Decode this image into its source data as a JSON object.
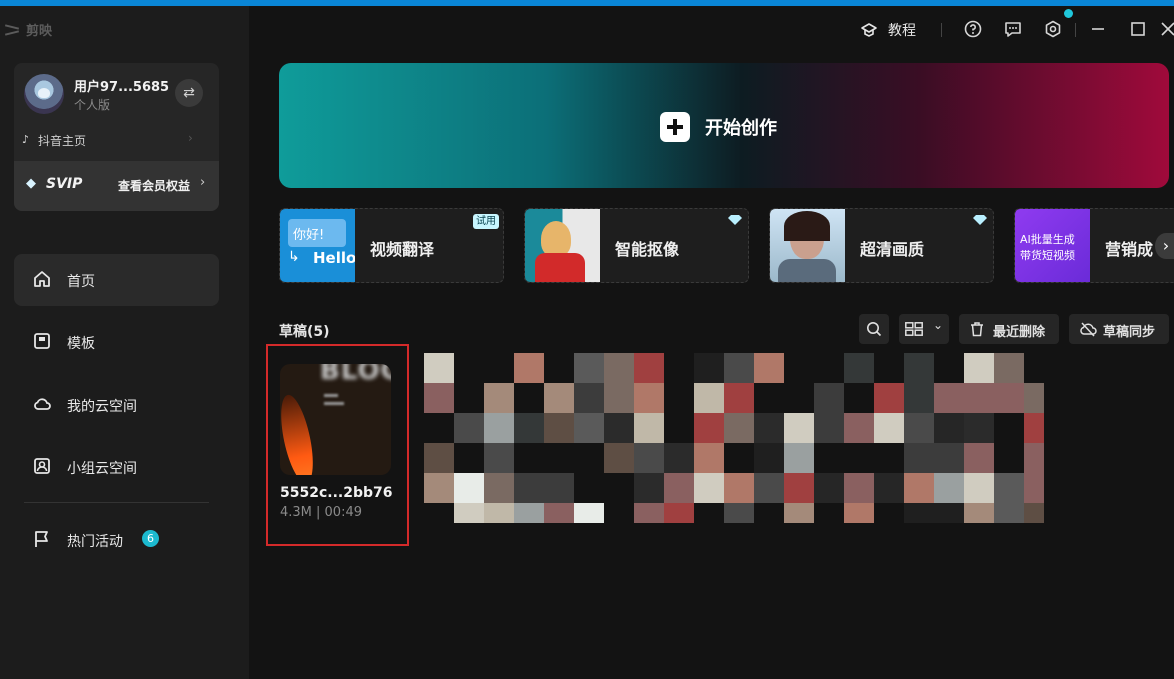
{
  "app": {
    "logo_text": "剪映"
  },
  "user": {
    "name": "用户97...5685",
    "plan": "个人版",
    "douyin_label": "抖音主页",
    "svip_label": "SVIP",
    "svip_benefit": "查看会员权益"
  },
  "nav": [
    {
      "label": "首页",
      "icon": "home-icon",
      "active": true
    },
    {
      "label": "模板",
      "icon": "template-icon"
    },
    {
      "label": "我的云空间",
      "icon": "cloud-icon"
    },
    {
      "label": "小组云空间",
      "icon": "group-cloud-icon"
    },
    {
      "label": "热门活动",
      "icon": "flag-icon",
      "badge": "6"
    }
  ],
  "topbar": {
    "tutorial_label": "教程"
  },
  "banner": {
    "label": "开始创作"
  },
  "features": [
    {
      "label": "视频翻译",
      "badge": "试用",
      "thumb_text_1": "你好!",
      "thumb_text_2": "Hello"
    },
    {
      "label": "智能抠像",
      "badge_icon": "diamond-icon"
    },
    {
      "label": "超清画质",
      "badge_icon": "diamond-icon"
    },
    {
      "label": "营销成",
      "thumb_text_1": "AI批量生成",
      "thumb_text_2": "带货短视频"
    }
  ],
  "drafts": {
    "title": "草稿(5)",
    "recent_delete_label": "最近删除",
    "sync_label": "草稿同步",
    "items": [
      {
        "name": "5552c...2bb76",
        "meta": "4.3M | 00:49",
        "thumb_text": "BLOG"
      }
    ]
  },
  "colors": {
    "accent": "#1cb9cf",
    "selection_border": "#d42a2a",
    "banner_start": "#0f9c9a",
    "banner_end": "#a00a3b"
  }
}
